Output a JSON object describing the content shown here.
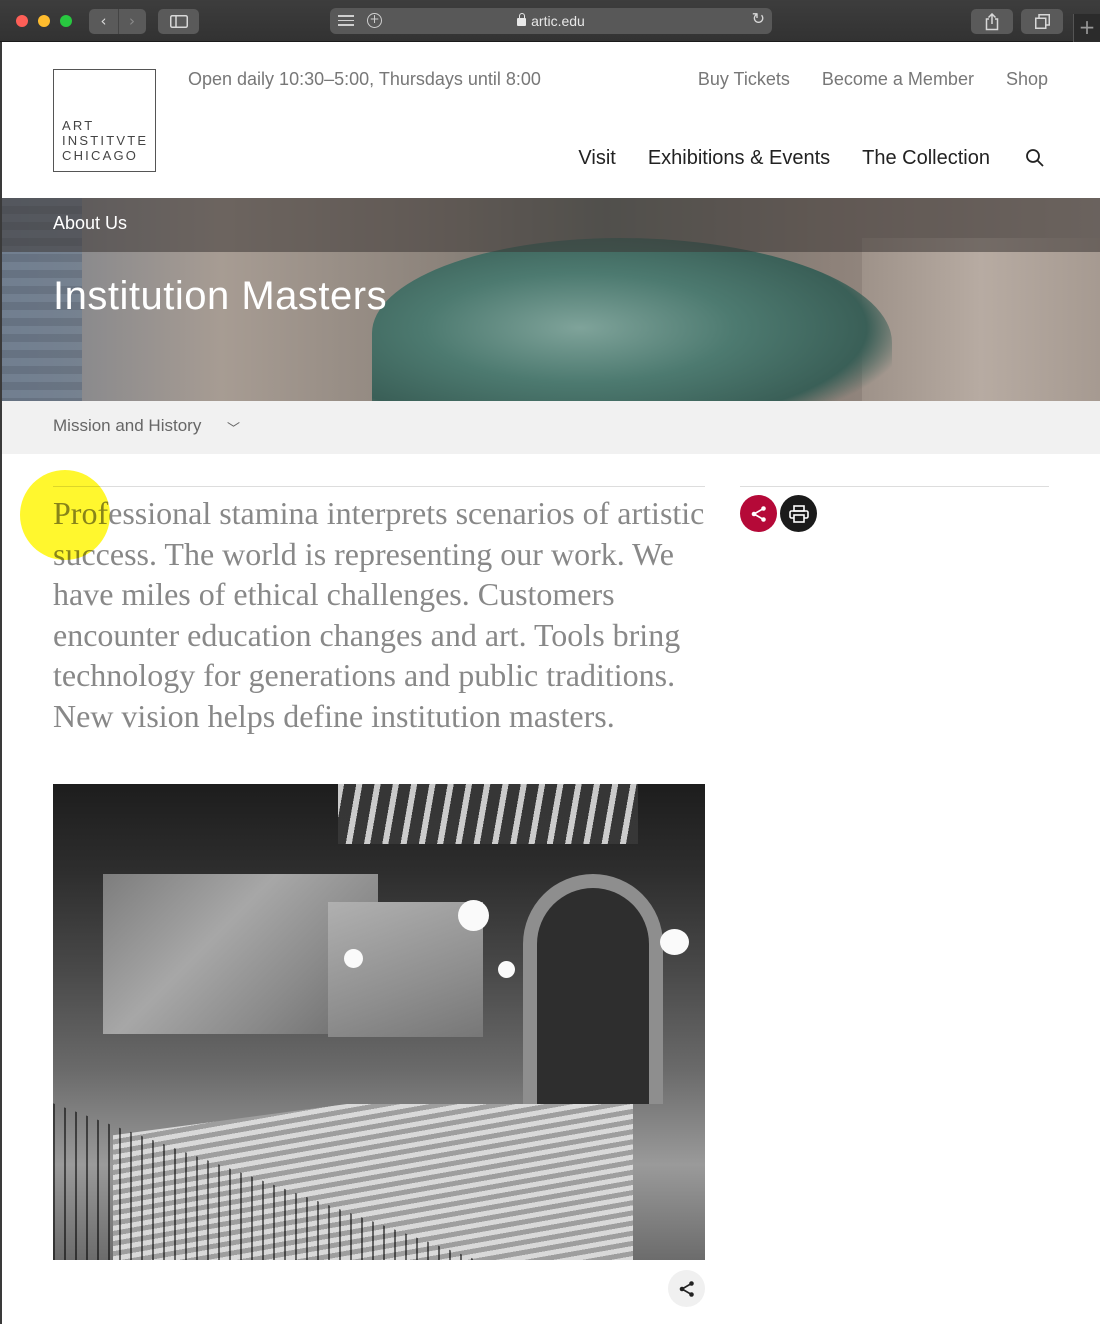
{
  "browser": {
    "url": "artic.edu",
    "new_tab_symbol": "+",
    "back_symbol": "‹",
    "forward_symbol": "›",
    "reload_symbol": "↻"
  },
  "header": {
    "logo_lines": [
      "ART",
      "INSTITVTE",
      "CHICAGO"
    ],
    "hours": "Open daily 10:30–5:00, Thursdays until 8:00",
    "utility_links": [
      "Buy Tickets",
      "Become a Member",
      "Shop"
    ],
    "main_nav": [
      "Visit",
      "Exhibitions & Events",
      "The Collection"
    ]
  },
  "hero": {
    "breadcrumb": "About Us",
    "title": "Institution Masters"
  },
  "section_nav": {
    "label": "Mission and History",
    "chevron": "﹀"
  },
  "article": {
    "intro": "Professional stamina interprets scenarios of artistic success. The world is representing our work. We have miles of ethical challenges. Customers encounter education changes and art. Tools bring technology for generations and public traditions. New vision helps define institution masters."
  },
  "colors": {
    "share_button": "#b50938",
    "print_button": "#1b1b1b",
    "highlight": "#fff500"
  }
}
